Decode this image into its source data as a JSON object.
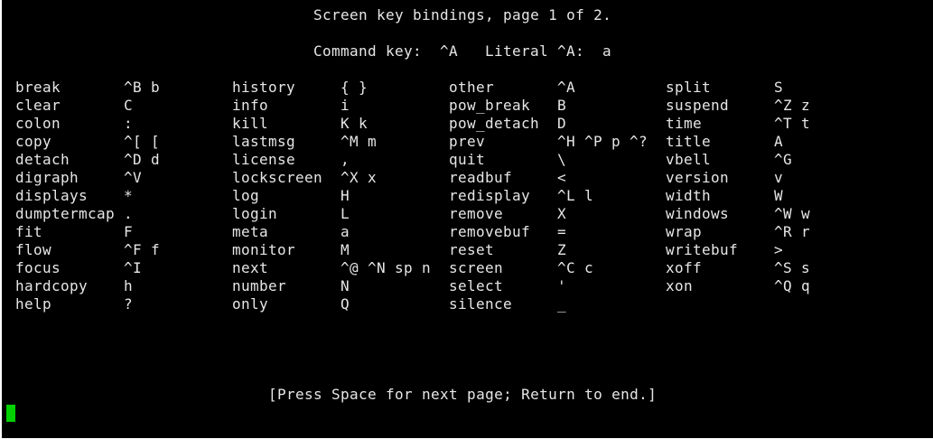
{
  "header": {
    "title": "Screen key bindings, page 1 of 2.",
    "command_key_label": "Command key:",
    "command_key_value": "^A",
    "literal_label": "Literal ^A:",
    "literal_value": "a"
  },
  "columns": [
    [
      {
        "cmd": "break",
        "key": "^B b"
      },
      {
        "cmd": "clear",
        "key": "C"
      },
      {
        "cmd": "colon",
        "key": ":"
      },
      {
        "cmd": "copy",
        "key": "^[ ["
      },
      {
        "cmd": "detach",
        "key": "^D d"
      },
      {
        "cmd": "digraph",
        "key": "^V"
      },
      {
        "cmd": "displays",
        "key": "*"
      },
      {
        "cmd": "dumptermcap",
        "key": "."
      },
      {
        "cmd": "fit",
        "key": "F"
      },
      {
        "cmd": "flow",
        "key": "^F f"
      },
      {
        "cmd": "focus",
        "key": "^I"
      },
      {
        "cmd": "hardcopy",
        "key": "h"
      },
      {
        "cmd": "help",
        "key": "?"
      }
    ],
    [
      {
        "cmd": "history",
        "key": "{ }"
      },
      {
        "cmd": "info",
        "key": "i"
      },
      {
        "cmd": "kill",
        "key": "K k"
      },
      {
        "cmd": "lastmsg",
        "key": "^M m"
      },
      {
        "cmd": "license",
        "key": ","
      },
      {
        "cmd": "lockscreen",
        "key": "^X x"
      },
      {
        "cmd": "log",
        "key": "H"
      },
      {
        "cmd": "login",
        "key": "L"
      },
      {
        "cmd": "meta",
        "key": "a"
      },
      {
        "cmd": "monitor",
        "key": "M"
      },
      {
        "cmd": "next",
        "key": "^@ ^N sp n"
      },
      {
        "cmd": "number",
        "key": "N"
      },
      {
        "cmd": "only",
        "key": "Q"
      }
    ],
    [
      {
        "cmd": "other",
        "key": "^A"
      },
      {
        "cmd": "pow_break",
        "key": "B"
      },
      {
        "cmd": "pow_detach",
        "key": "D"
      },
      {
        "cmd": "prev",
        "key": "^H ^P p ^?"
      },
      {
        "cmd": "quit",
        "key": "\\"
      },
      {
        "cmd": "readbuf",
        "key": "<"
      },
      {
        "cmd": "redisplay",
        "key": "^L l"
      },
      {
        "cmd": "remove",
        "key": "X"
      },
      {
        "cmd": "removebuf",
        "key": "="
      },
      {
        "cmd": "reset",
        "key": "Z"
      },
      {
        "cmd": "screen",
        "key": "^C c"
      },
      {
        "cmd": "select",
        "key": "'"
      },
      {
        "cmd": "silence",
        "key": "_"
      }
    ],
    [
      {
        "cmd": "split",
        "key": "S"
      },
      {
        "cmd": "suspend",
        "key": "^Z z"
      },
      {
        "cmd": "time",
        "key": "^T t"
      },
      {
        "cmd": "title",
        "key": "A"
      },
      {
        "cmd": "vbell",
        "key": "^G"
      },
      {
        "cmd": "version",
        "key": "v"
      },
      {
        "cmd": "width",
        "key": "W"
      },
      {
        "cmd": "windows",
        "key": "^W w"
      },
      {
        "cmd": "wrap",
        "key": "^R r"
      },
      {
        "cmd": "writebuf",
        "key": ">"
      },
      {
        "cmd": "xoff",
        "key": "^S s"
      },
      {
        "cmd": "xon",
        "key": "^Q q"
      }
    ]
  ],
  "footer": {
    "prompt": "[Press Space for next page; Return to end.]"
  },
  "colors": {
    "background": "#000000",
    "foreground": "#e6e6e6",
    "cursor": "#00d000"
  }
}
